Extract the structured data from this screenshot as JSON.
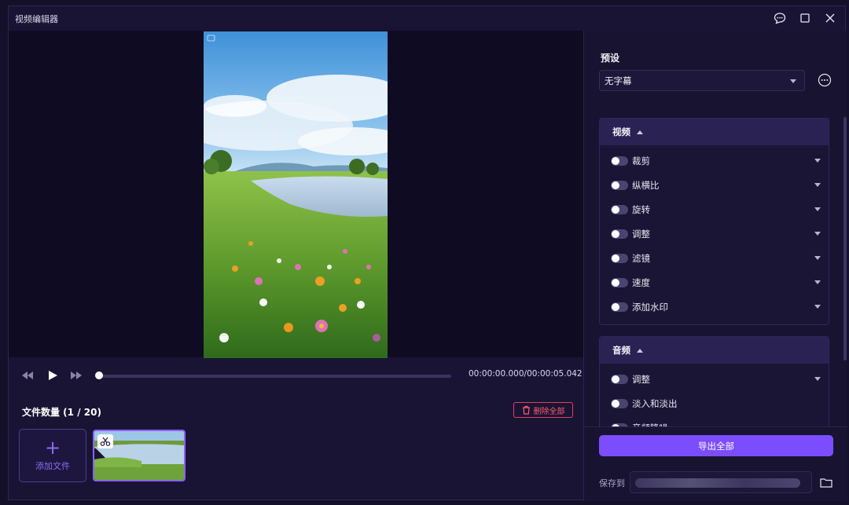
{
  "window": {
    "title": "视频编辑器"
  },
  "player": {
    "timecode": "00:00:00.000/00:00:05.042",
    "progress": 0.0
  },
  "files": {
    "count_label": "文件数量 (1 / 20)",
    "delete_all_label": "删除全部",
    "add_file_label": "添加文件"
  },
  "preset": {
    "label": "预设",
    "selected": "无字幕"
  },
  "video_section": {
    "title": "视频",
    "items": [
      {
        "label": "裁剪"
      },
      {
        "label": "纵横比"
      },
      {
        "label": "旋转"
      },
      {
        "label": "调整"
      },
      {
        "label": "滤镜"
      },
      {
        "label": "速度"
      },
      {
        "label": "添加水印"
      }
    ]
  },
  "audio_section": {
    "title": "音频",
    "items": [
      {
        "label": "调整"
      },
      {
        "label": "淡入和淡出"
      },
      {
        "label": "音频降噪"
      }
    ]
  },
  "footer": {
    "export_label": "导出全部",
    "save_to_label": "保存到"
  },
  "colors": {
    "accent": "#7c4dff",
    "danger": "#e0405a",
    "background": "#191434"
  }
}
